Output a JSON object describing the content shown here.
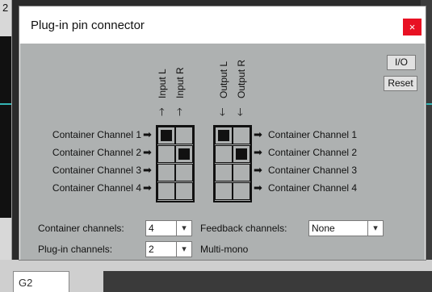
{
  "background": {
    "corner_number": "2",
    "bottom_field": "G2"
  },
  "dialog": {
    "title": "Plug-in pin connector",
    "close_icon": "close-icon",
    "close_glyph": "×"
  },
  "buttons": {
    "io": "I/O",
    "reset": "Reset"
  },
  "columns": {
    "inputs": [
      "Input L",
      "Input R"
    ],
    "outputs": [
      "Output L",
      "Output R"
    ]
  },
  "channels": [
    "Container Channel 1",
    "Container Channel 2",
    "Container Channel 3",
    "Container Channel 4"
  ],
  "input_matrix": [
    [
      1,
      0
    ],
    [
      0,
      1
    ],
    [
      0,
      0
    ],
    [
      0,
      0
    ]
  ],
  "output_matrix": [
    [
      1,
      0
    ],
    [
      0,
      1
    ],
    [
      0,
      0
    ],
    [
      0,
      0
    ]
  ],
  "settings": {
    "container_channels_label": "Container channels:",
    "container_channels_value": "4",
    "feedback_channels_label": "Feedback channels:",
    "feedback_channels_value": "None",
    "plugin_channels_label": "Plug-in channels:",
    "plugin_channels_value": "2",
    "multimono_label": "Multi-mono"
  },
  "glyphs": {
    "right_arrow": "➡",
    "up_arrow": "🡑",
    "down_arrow": "🡓",
    "dropdown": "▾"
  }
}
